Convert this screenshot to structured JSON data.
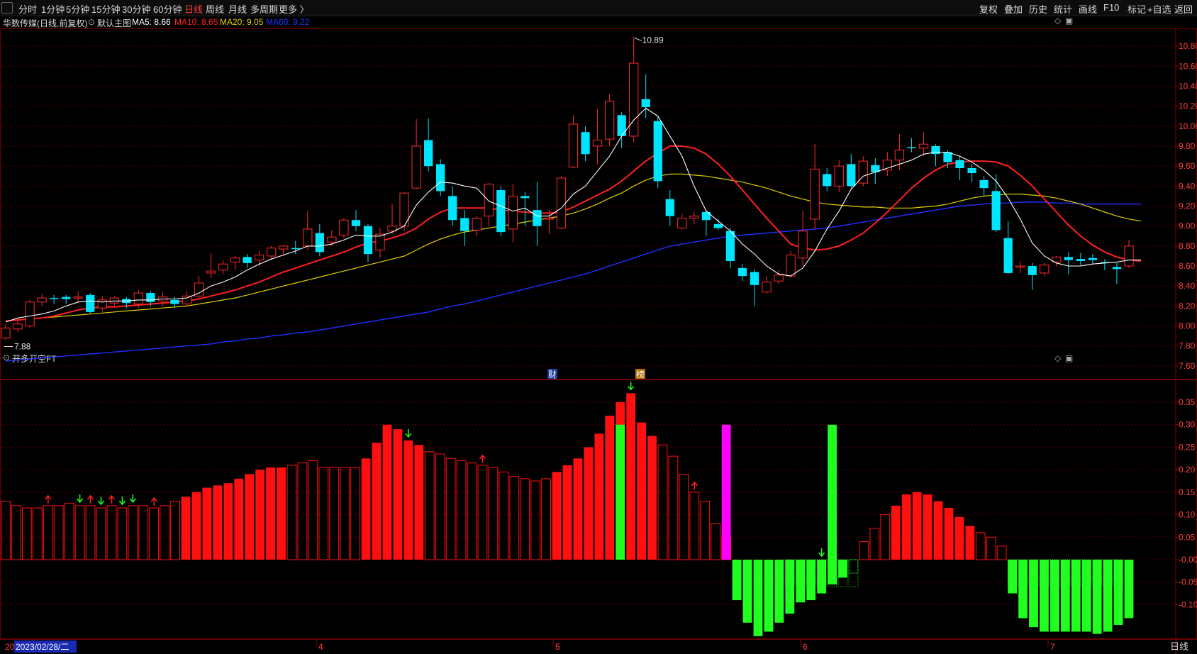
{
  "toolbar": {
    "left_items": [
      "分时",
      "1分钟",
      "5分钟",
      "15分钟",
      "30分钟",
      "60分钟",
      "日线",
      "周线",
      "月线",
      "多周期",
      "更多 〉"
    ],
    "active_item": "日线",
    "right_items": [
      "复权",
      "叠加",
      "历史",
      "统计",
      "画线",
      "F10",
      "标记",
      "+自选",
      "返回"
    ]
  },
  "legend": {
    "stock": "华数传媒(日线,前复权)",
    "template": "默认主图",
    "ma5": "MA5: 8.66",
    "ma10": "MA10: 8.65",
    "ma20": "MA20: 9.05",
    "ma60": "MA60: 9.22"
  },
  "colors": {
    "up": "#ff2a2a",
    "down": "#00e5ff",
    "ma5": "#ffffff",
    "ma10": "#ff2020",
    "ma20": "#e0d000",
    "ma60": "#2030ff",
    "grid": "#5a0000",
    "axis_text": "#ff4040",
    "osc_up": "#ff1010",
    "osc_down": "#20ff20",
    "magenta": "#ff00ff"
  },
  "indicator_title": "开多开空FT",
  "annotations": {
    "high_label": "10.89",
    "low_label": "7.88",
    "cai_badge": "财",
    "bang_badge": "榜"
  },
  "footer": {
    "cursor_date": "2023/02/28/二",
    "cursor_prefix": "20",
    "month_labels": [
      "4",
      "5",
      "6",
      "7"
    ],
    "period": "日线"
  },
  "chart_data": [
    {
      "type": "candlestick",
      "title": "华数传媒(日线,前复权)",
      "ylim": [
        7.5,
        10.95
      ],
      "yticks": [
        "10.80",
        "10.60",
        "10.40",
        "10.20",
        "10.00",
        "9.80",
        "9.60",
        "9.40",
        "9.20",
        "9.00",
        "8.80",
        "8.60",
        "8.40",
        "8.20",
        "8.00",
        "7.80",
        "7.60"
      ],
      "candles": [
        [
          7.88,
          7.98,
          8.02,
          7.86
        ],
        [
          7.97,
          8.02,
          8.08,
          7.94
        ],
        [
          8.0,
          8.24,
          8.26,
          7.98
        ],
        [
          8.24,
          8.28,
          8.32,
          8.2
        ],
        [
          8.28,
          8.27,
          8.31,
          8.22
        ],
        [
          8.29,
          8.27,
          8.31,
          8.22
        ],
        [
          8.28,
          8.29,
          8.35,
          8.24
        ],
        [
          8.31,
          8.14,
          8.33,
          8.12
        ],
        [
          8.18,
          8.26,
          8.3,
          8.14
        ],
        [
          8.23,
          8.28,
          8.3,
          8.2
        ],
        [
          8.27,
          8.23,
          8.29,
          8.18
        ],
        [
          8.22,
          8.33,
          8.36,
          8.18
        ],
        [
          8.33,
          8.24,
          8.35,
          8.2
        ],
        [
          8.25,
          8.29,
          8.34,
          8.2
        ],
        [
          8.26,
          8.22,
          8.29,
          8.18
        ],
        [
          8.22,
          8.3,
          8.35,
          8.19
        ],
        [
          8.3,
          8.43,
          8.5,
          8.27
        ],
        [
          8.53,
          8.55,
          8.73,
          8.48
        ],
        [
          8.56,
          8.62,
          8.66,
          8.52
        ],
        [
          8.64,
          8.68,
          8.7,
          8.56
        ],
        [
          8.69,
          8.63,
          8.72,
          8.58
        ],
        [
          8.66,
          8.71,
          8.75,
          8.6
        ],
        [
          8.7,
          8.78,
          8.8,
          8.66
        ],
        [
          8.77,
          8.8,
          8.81,
          8.7
        ],
        [
          8.78,
          8.77,
          8.85,
          8.72
        ],
        [
          8.8,
          8.97,
          9.15,
          8.76
        ],
        [
          8.93,
          8.74,
          9.02,
          8.7
        ],
        [
          8.84,
          8.89,
          8.96,
          8.8
        ],
        [
          8.91,
          9.06,
          9.08,
          8.88
        ],
        [
          9.06,
          9.0,
          9.16,
          8.95
        ],
        [
          9.0,
          8.72,
          9.02,
          8.64
        ],
        [
          8.76,
          8.92,
          8.98,
          8.68
        ],
        [
          8.95,
          9.0,
          9.22,
          8.92
        ],
        [
          9.0,
          9.33,
          9.34,
          8.95
        ],
        [
          9.38,
          9.8,
          10.07,
          9.37
        ],
        [
          9.86,
          9.6,
          10.08,
          9.55
        ],
        [
          9.62,
          9.35,
          9.67,
          9.3
        ],
        [
          9.3,
          9.06,
          9.4,
          9.0
        ],
        [
          9.08,
          8.95,
          9.16,
          8.8
        ],
        [
          8.96,
          9.08,
          9.1,
          8.9
        ],
        [
          9.1,
          9.42,
          9.43,
          9.0
        ],
        [
          9.36,
          8.94,
          9.4,
          8.9
        ],
        [
          8.97,
          9.3,
          9.42,
          8.84
        ],
        [
          9.3,
          9.28,
          9.34,
          9.0
        ],
        [
          9.16,
          9.0,
          9.44,
          8.8
        ],
        [
          9.08,
          9.08,
          9.16,
          8.92
        ],
        [
          8.98,
          9.48,
          9.5,
          8.97
        ],
        [
          9.59,
          10.02,
          10.11,
          9.58
        ],
        [
          9.94,
          9.72,
          10.0,
          9.65
        ],
        [
          9.8,
          9.86,
          10.17,
          9.62
        ],
        [
          9.87,
          10.25,
          10.32,
          9.8
        ],
        [
          10.11,
          9.9,
          10.14,
          9.78
        ],
        [
          9.9,
          10.63,
          10.89,
          9.84
        ],
        [
          10.27,
          10.19,
          10.52,
          10.08
        ],
        [
          10.05,
          9.45,
          10.1,
          9.38
        ],
        [
          9.27,
          9.1,
          9.36,
          9.0
        ],
        [
          8.98,
          9.08,
          9.12,
          8.97
        ],
        [
          9.08,
          9.1,
          9.14,
          9.02
        ],
        [
          9.14,
          9.06,
          9.16,
          8.9
        ],
        [
          9.02,
          8.98,
          9.07,
          8.96
        ],
        [
          8.95,
          8.65,
          8.98,
          8.58
        ],
        [
          8.58,
          8.5,
          8.62,
          8.45
        ],
        [
          8.54,
          8.41,
          8.57,
          8.2
        ],
        [
          8.34,
          8.44,
          8.5,
          8.32
        ],
        [
          8.45,
          8.51,
          8.56,
          8.42
        ],
        [
          8.5,
          8.71,
          8.75,
          8.48
        ],
        [
          8.68,
          8.95,
          9.15,
          8.6
        ],
        [
          9.07,
          9.57,
          9.82,
          8.97
        ],
        [
          9.52,
          9.4,
          9.58,
          9.35
        ],
        [
          9.4,
          9.6,
          9.66,
          9.34
        ],
        [
          9.62,
          9.4,
          9.72,
          9.38
        ],
        [
          9.43,
          9.65,
          9.7,
          9.4
        ],
        [
          9.61,
          9.54,
          9.68,
          9.42
        ],
        [
          9.56,
          9.66,
          9.74,
          9.5
        ],
        [
          9.66,
          9.76,
          9.92,
          9.56
        ],
        [
          9.79,
          9.78,
          9.88,
          9.74
        ],
        [
          9.78,
          9.82,
          9.94,
          9.7
        ],
        [
          9.8,
          9.72,
          9.82,
          9.6
        ],
        [
          9.74,
          9.64,
          9.76,
          9.58
        ],
        [
          9.66,
          9.58,
          9.7,
          9.46
        ],
        [
          9.58,
          9.53,
          9.62,
          9.44
        ],
        [
          9.46,
          9.38,
          9.5,
          9.3
        ],
        [
          9.35,
          8.96,
          9.52,
          8.94
        ],
        [
          8.88,
          8.53,
          9.05,
          8.52
        ],
        [
          8.6,
          8.6,
          8.64,
          8.53
        ],
        [
          8.6,
          8.51,
          8.63,
          8.36
        ],
        [
          8.53,
          8.61,
          8.63,
          8.5
        ],
        [
          8.64,
          8.69,
          8.7,
          8.6
        ],
        [
          8.69,
          8.66,
          8.74,
          8.52
        ],
        [
          8.67,
          8.65,
          8.73,
          8.61
        ],
        [
          8.68,
          8.66,
          8.72,
          8.62
        ],
        [
          8.64,
          8.63,
          8.67,
          8.56
        ],
        [
          8.59,
          8.57,
          8.63,
          8.42
        ],
        [
          8.6,
          8.8,
          8.86,
          8.58
        ]
      ],
      "ma5": [
        8.04,
        8.08,
        8.1,
        8.12,
        8.15,
        8.2,
        8.24,
        8.25,
        8.24,
        8.25,
        8.25,
        8.26,
        8.26,
        8.27,
        8.27,
        8.28,
        8.33,
        8.4,
        8.44,
        8.49,
        8.56,
        8.62,
        8.67,
        8.71,
        8.75,
        8.8,
        8.8,
        8.82,
        8.86,
        8.91,
        8.9,
        8.9,
        8.94,
        9.0,
        9.21,
        9.34,
        9.44,
        9.43,
        9.4,
        9.38,
        9.25,
        9.2,
        9.15,
        9.18,
        9.1,
        9.1,
        9.18,
        9.32,
        9.4,
        9.55,
        9.7,
        9.9,
        10.06,
        10.18,
        10.1,
        9.9,
        9.7,
        9.4,
        9.15,
        9.05,
        8.95,
        8.82,
        8.72,
        8.6,
        8.52,
        8.5,
        8.58,
        8.75,
        8.97,
        9.15,
        9.37,
        9.5,
        9.54,
        9.58,
        9.62,
        9.66,
        9.72,
        9.74,
        9.74,
        9.7,
        9.64,
        9.56,
        9.45,
        9.28,
        9.07,
        8.83,
        8.7,
        8.63,
        8.6,
        8.6,
        8.62,
        8.63,
        8.64,
        8.66,
        8.66
      ],
      "ma10": [
        8.05,
        8.06,
        8.07,
        8.08,
        8.1,
        8.13,
        8.16,
        8.18,
        8.19,
        8.19,
        8.2,
        8.21,
        8.22,
        8.23,
        8.24,
        8.25,
        8.27,
        8.3,
        8.33,
        8.36,
        8.4,
        8.44,
        8.49,
        8.54,
        8.58,
        8.62,
        8.66,
        8.7,
        8.74,
        8.79,
        8.83,
        8.85,
        8.88,
        8.92,
        8.98,
        9.07,
        9.14,
        9.18,
        9.18,
        9.18,
        9.18,
        9.16,
        9.15,
        9.14,
        9.13,
        9.13,
        9.14,
        9.19,
        9.25,
        9.31,
        9.37,
        9.45,
        9.55,
        9.65,
        9.73,
        9.8,
        9.8,
        9.78,
        9.72,
        9.62,
        9.5,
        9.36,
        9.22,
        9.08,
        8.95,
        8.82,
        8.78,
        8.76,
        8.77,
        8.8,
        8.86,
        8.93,
        9.03,
        9.14,
        9.26,
        9.38,
        9.48,
        9.56,
        9.62,
        9.64,
        9.65,
        9.65,
        9.64,
        9.6,
        9.51,
        9.4,
        9.27,
        9.14,
        9.01,
        8.9,
        8.81,
        8.74,
        8.69,
        8.66,
        8.65
      ],
      "ma20": [
        8.05,
        8.06,
        8.07,
        8.08,
        8.09,
        8.1,
        8.11,
        8.12,
        8.13,
        8.14,
        8.15,
        8.16,
        8.17,
        8.18,
        8.19,
        8.2,
        8.22,
        8.24,
        8.26,
        8.28,
        8.31,
        8.34,
        8.37,
        8.4,
        8.43,
        8.46,
        8.49,
        8.52,
        8.55,
        8.58,
        8.61,
        8.64,
        8.67,
        8.7,
        8.76,
        8.82,
        8.87,
        8.91,
        8.94,
        8.96,
        8.98,
        9.0,
        9.02,
        9.04,
        9.06,
        9.08,
        9.1,
        9.13,
        9.17,
        9.22,
        9.28,
        9.33,
        9.4,
        9.46,
        9.5,
        9.52,
        9.52,
        9.51,
        9.5,
        9.48,
        9.46,
        9.44,
        9.41,
        9.38,
        9.34,
        9.3,
        9.27,
        9.24,
        9.22,
        9.21,
        9.2,
        9.19,
        9.19,
        9.18,
        9.18,
        9.18,
        9.19,
        9.2,
        9.22,
        9.25,
        9.28,
        9.3,
        9.31,
        9.32,
        9.32,
        9.31,
        9.3,
        9.28,
        9.25,
        9.22,
        9.18,
        9.14,
        9.1,
        9.07,
        9.05
      ],
      "ma60": [
        7.65,
        7.66,
        7.67,
        7.68,
        7.69,
        7.7,
        7.71,
        7.72,
        7.73,
        7.74,
        7.75,
        7.76,
        7.77,
        7.78,
        7.79,
        7.8,
        7.81,
        7.82,
        7.84,
        7.85,
        7.87,
        7.88,
        7.9,
        7.91,
        7.93,
        7.94,
        7.96,
        7.98,
        8.0,
        8.02,
        8.04,
        8.06,
        8.08,
        8.1,
        8.12,
        8.14,
        8.17,
        8.2,
        8.22,
        8.25,
        8.28,
        8.31,
        8.34,
        8.37,
        8.4,
        8.43,
        8.46,
        8.49,
        8.52,
        8.56,
        8.6,
        8.64,
        8.68,
        8.72,
        8.76,
        8.8,
        8.82,
        8.84,
        8.86,
        8.88,
        8.9,
        8.91,
        8.92,
        8.93,
        8.94,
        8.95,
        8.96,
        8.97,
        8.98,
        9.0,
        9.02,
        9.04,
        9.06,
        9.08,
        9.1,
        9.12,
        9.14,
        9.16,
        9.18,
        9.2,
        9.21,
        9.22,
        9.23,
        9.23,
        9.24,
        9.24,
        9.24,
        9.23,
        9.23,
        9.22,
        9.22,
        9.22,
        9.22,
        9.22,
        9.22
      ]
    },
    {
      "type": "bar",
      "title": "开多开空FT",
      "ylim": [
        -0.175,
        0.38
      ],
      "yticks": [
        "0.35",
        "0.30",
        "0.25",
        "0.20",
        "0.15",
        "0.10",
        "0.05",
        "-0.00",
        "-0.05",
        "-0.10"
      ],
      "values": [
        0.13,
        0.12,
        0.115,
        0.115,
        0.12,
        0.12,
        0.125,
        0.12,
        0.12,
        0.115,
        0.12,
        0.115,
        0.12,
        0.12,
        0.115,
        0.12,
        0.13,
        0.14,
        0.15,
        0.16,
        0.165,
        0.17,
        0.18,
        0.19,
        0.2,
        0.205,
        0.205,
        0.21,
        0.215,
        0.22,
        0.205,
        0.205,
        0.205,
        0.205,
        0.225,
        0.26,
        0.3,
        0.29,
        0.265,
        0.255,
        0.24,
        0.235,
        0.225,
        0.22,
        0.215,
        0.21,
        0.205,
        0.195,
        0.185,
        0.18,
        0.175,
        0.18,
        0.195,
        0.21,
        0.225,
        0.25,
        0.28,
        0.32,
        0.35,
        0.37,
        0.305,
        0.275,
        0.255,
        0.23,
        0.19,
        0.15,
        0.13,
        0.08,
        0.05,
        -0.09,
        -0.14,
        -0.17,
        -0.16,
        -0.14,
        -0.12,
        -0.095,
        -0.09,
        -0.075,
        -0.055,
        -0.04,
        -0.03,
        0.04,
        0.07,
        0.1,
        0.12,
        0.145,
        0.15,
        0.145,
        0.13,
        0.115,
        0.095,
        0.075,
        0.06,
        0.05,
        0.03,
        -0.075,
        -0.13,
        -0.15,
        -0.16,
        -0.16,
        -0.16,
        -0.16,
        -0.16,
        -0.165,
        -0.16,
        -0.145,
        -0.13
      ],
      "filled_up": [
        17,
        18,
        19,
        20,
        21,
        22,
        23,
        24,
        25,
        26,
        34,
        35,
        36,
        37,
        38,
        39,
        52,
        53,
        54,
        55,
        56,
        57,
        58,
        59,
        60,
        61,
        84,
        85,
        86,
        87,
        88,
        89,
        90,
        91
      ],
      "signals_up_arrows": [
        4,
        8,
        10,
        14,
        45,
        65
      ],
      "signals_down_arrows": [
        7,
        9,
        11,
        12,
        38,
        59,
        77
      ],
      "green_spikes": [
        58,
        78
      ],
      "magenta_spike": 68,
      "spike_value": 0.3
    }
  ]
}
